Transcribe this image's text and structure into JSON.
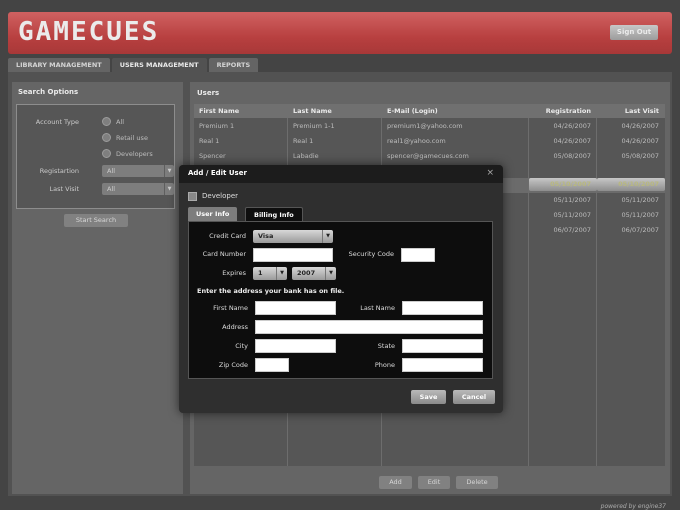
{
  "header": {
    "logo": "GAMECUES",
    "sign_out": "Sign Out"
  },
  "tabs": [
    {
      "label": "LIBRARY MANAGEMENT"
    },
    {
      "label": "USERS MANAGEMENT"
    },
    {
      "label": "REPORTS"
    }
  ],
  "search": {
    "title": "Search Options",
    "account_type_label": "Account Type",
    "account_types": [
      "All",
      "Retail use",
      "Developers"
    ],
    "registration_label": "Registartion",
    "registration_value": "All",
    "last_visit_label": "Last Visit",
    "last_visit_value": "All",
    "start_button": "Start Search"
  },
  "users": {
    "title": "Users",
    "columns": [
      "First Name",
      "Last Name",
      "E-Mail (Login)",
      "Registration",
      "Last Visit"
    ],
    "rows": [
      {
        "first": "Premium 1",
        "last": "Premium 1-1",
        "email": "premium1@yahoo.com",
        "reg": "04/26/2007",
        "visit": "04/26/2007"
      },
      {
        "first": "Real 1",
        "last": "Real 1",
        "email": "real1@yahoo.com",
        "reg": "04/26/2007",
        "visit": "04/26/2007"
      },
      {
        "first": "Spencer",
        "last": "Labadie",
        "email": "spencer@gamecues.com",
        "reg": "05/08/2007",
        "visit": "05/08/2007"
      },
      {
        "first": "",
        "last": "",
        "email": "",
        "reg": "05/10/2007",
        "visit": "05/10/2007"
      },
      {
        "first": "",
        "last": "",
        "email": "",
        "reg": "05/11/2007",
        "visit": "05/11/2007"
      },
      {
        "first": "",
        "last": "",
        "email": "",
        "reg": "05/11/2007",
        "visit": "05/11/2007"
      },
      {
        "first": "",
        "last": "",
        "email": "",
        "reg": "06/07/2007",
        "visit": "06/07/2007"
      }
    ],
    "buttons": {
      "add": "Add",
      "edit": "Edit",
      "delete": "Delete"
    }
  },
  "footer": "powered by engine37",
  "modal": {
    "title": "Add / Edit User",
    "close": "×",
    "developer_label": "Developer",
    "tab_user_info": "User Info",
    "tab_billing_info": "Billing Info",
    "credit_card_label": "Credit Card",
    "credit_card_value": "Visa",
    "card_number_label": "Card Number",
    "security_code_label": "Security Code",
    "expires_label": "Expires",
    "expires_month": "1",
    "expires_year": "2007",
    "address_note": "Enter the address your bank has on file.",
    "first_name_label": "First Name",
    "last_name_label": "Last Name",
    "address_label": "Address",
    "city_label": "City",
    "state_label": "State",
    "zip_label": "Zip Code",
    "phone_label": "Phone",
    "save": "Save",
    "cancel": "Cancel"
  }
}
